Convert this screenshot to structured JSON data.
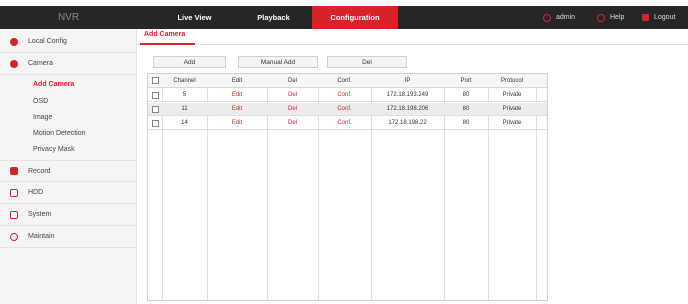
{
  "header": {
    "brand": "NVR",
    "nav": [
      "Live View",
      "Playback",
      "Configuration"
    ],
    "active_nav": "Configuration",
    "right": {
      "user": "admin",
      "help": "Help",
      "logout": "Logout"
    }
  },
  "sidebar": {
    "local_config": "Local Config",
    "camera": "Camera",
    "camera_sub": [
      "Add Camera",
      "OSD",
      "Image",
      "Motion Detection",
      "Privacy Mask"
    ],
    "record": "Record",
    "hdd": "HDD",
    "system": "System",
    "maintain": "Maintain"
  },
  "main": {
    "tab": "Add Camera",
    "buttons": {
      "add": "Add",
      "manual_add": "Manual Add",
      "del": "Del"
    },
    "columns": [
      "Channel",
      "Edit",
      "Del",
      "Conf.",
      "IP",
      "Port",
      "Protocol"
    ],
    "rows": [
      {
        "channel": "5",
        "edit": "Edit",
        "del": "Del",
        "conf": "Conf.",
        "ip": "172.18.193.249",
        "port": "80",
        "protocol": "Private"
      },
      {
        "channel": "11",
        "edit": "Edit",
        "del": "Del",
        "conf": "Conf.",
        "ip": "172.18.198.206",
        "port": "80",
        "protocol": "Private"
      },
      {
        "channel": "14",
        "edit": "Edit",
        "del": "Del",
        "conf": "Conf.",
        "ip": "172.18.198.22",
        "port": "80",
        "protocol": "Private"
      }
    ]
  },
  "colors": {
    "accent": "#d8222a",
    "topbar": "#262626"
  }
}
